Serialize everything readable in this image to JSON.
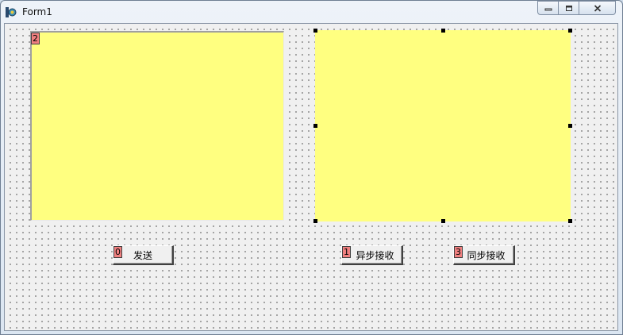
{
  "window": {
    "title": "Form1",
    "icon": "delphi-app-icon",
    "caption_buttons": [
      "minimize-icon",
      "restore-icon",
      "close-icon"
    ]
  },
  "colors": {
    "memo_background": "#ffff80",
    "tab_badge": "#f08080",
    "form_background": "#f0f0f0"
  },
  "memo_left": {
    "tab_order": "2",
    "text": ""
  },
  "memo_right": {
    "text": ""
  },
  "buttons": {
    "send": {
      "label": "发送",
      "tab_order": "0"
    },
    "async_receive": {
      "label": "异步接收",
      "tab_order": "1"
    },
    "sync_receive": {
      "label": "同步接收",
      "tab_order": "3"
    }
  }
}
